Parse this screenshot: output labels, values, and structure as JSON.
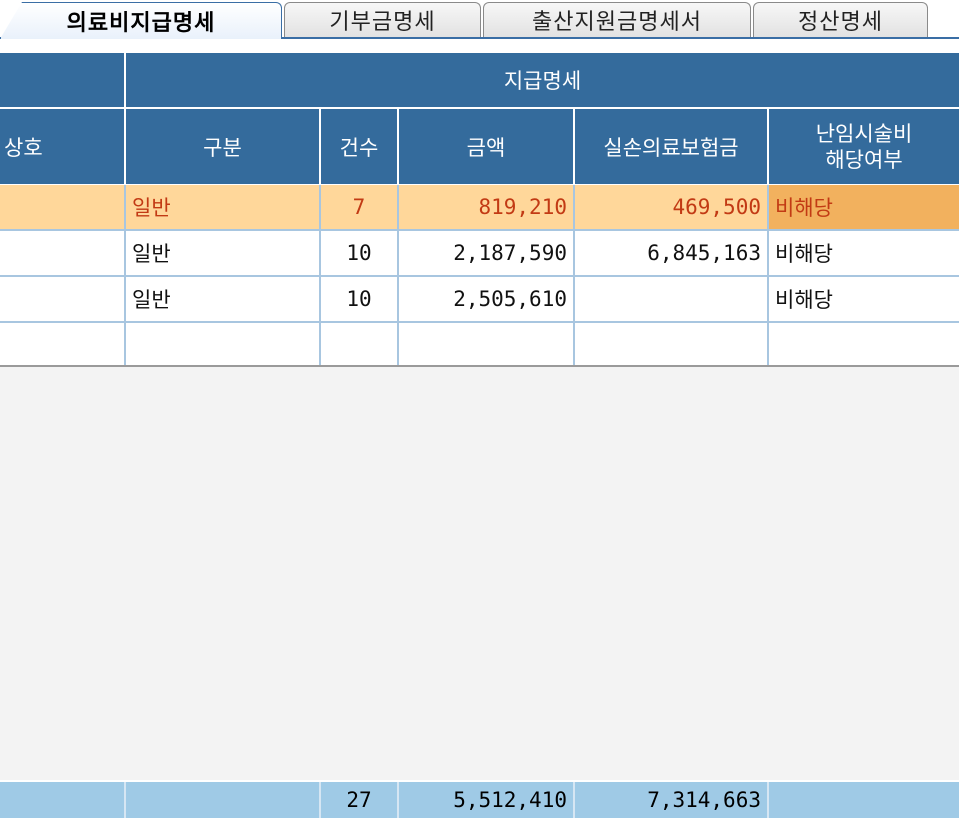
{
  "tabs": [
    {
      "label": "의료비지급명세",
      "active": true
    },
    {
      "label": "기부금명세",
      "active": false
    },
    {
      "label": "출산지원금명세서",
      "active": false
    },
    {
      "label": "정산명세",
      "active": false
    }
  ],
  "header": {
    "group": "지급명세",
    "col_shop": "상호",
    "col_type": "구분",
    "col_count": "건수",
    "col_amount": "금액",
    "col_insurance": "실손의료보험금",
    "col_infertility_line1": "난임시술비",
    "col_infertility_line2": "해당여부"
  },
  "rows": [
    {
      "type": "일반",
      "count": "7",
      "amount": "819,210",
      "insurance": "469,500",
      "infertility": "비해당",
      "selected": true
    },
    {
      "type": "일반",
      "count": "10",
      "amount": "2,187,590",
      "insurance": "6,845,163",
      "infertility": "비해당"
    },
    {
      "type": "일반",
      "count": "10",
      "amount": "2,505,610",
      "insurance": "",
      "infertility": "비해당"
    },
    {
      "type": "",
      "count": "",
      "amount": "",
      "insurance": "",
      "infertility": ""
    }
  ],
  "totals": {
    "count": "27",
    "amount": "5,512,410",
    "insurance": "7,314,663"
  },
  "colors": {
    "header_bg": "#346b9c",
    "selected_row": "#ffd79a",
    "selected_text": "#c23a14",
    "total_row": "#9fcae6"
  }
}
